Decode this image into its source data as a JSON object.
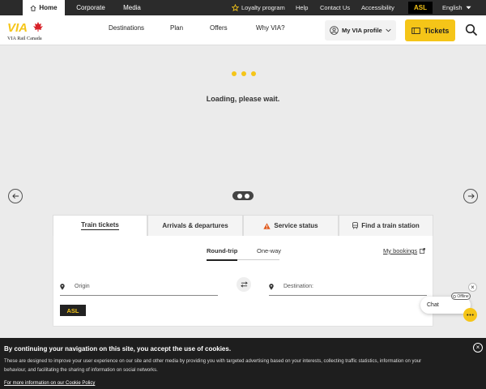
{
  "topbar": {
    "home": "Home",
    "corporate": "Corporate",
    "media": "Media",
    "loyalty": "Loyalty program",
    "help": "Help",
    "contact": "Contact Us",
    "accessibility": "Accessibility",
    "asl": "ASL",
    "language": "English"
  },
  "header": {
    "logo_text": "VIA Rail Canada",
    "nav": [
      "Destinations",
      "Plan",
      "Offers",
      "Why VIA?"
    ],
    "profile": "My VIA profile",
    "tickets": "Tickets"
  },
  "loading": {
    "text": "Loading, please wait."
  },
  "booking": {
    "tabs": [
      "Train tickets",
      "Arrivals & departures",
      "Service status",
      "Find a train station"
    ],
    "trip_types": [
      "Round-trip",
      "One-way"
    ],
    "my_bookings": "My bookings",
    "origin_placeholder": "Origin",
    "destination_placeholder": "Destination:",
    "asl": "ASL"
  },
  "chat": {
    "label": "Chat",
    "status": "Offline"
  },
  "cookie": {
    "title": "By continuing your navigation on this site, you accept the use of cookies.",
    "body": "These are designed to improve your user experience on our site and other media by providing you with targeted advertising based on your interests, collecting traffic statistics, information on your behaviour, and facilitating the sharing of information on social networks.",
    "link": "For more information on our Cookie Policy"
  },
  "colors": {
    "brand_yellow": "#f5c518",
    "dark": "#2b2b2b",
    "logo_red": "#d8232a"
  }
}
